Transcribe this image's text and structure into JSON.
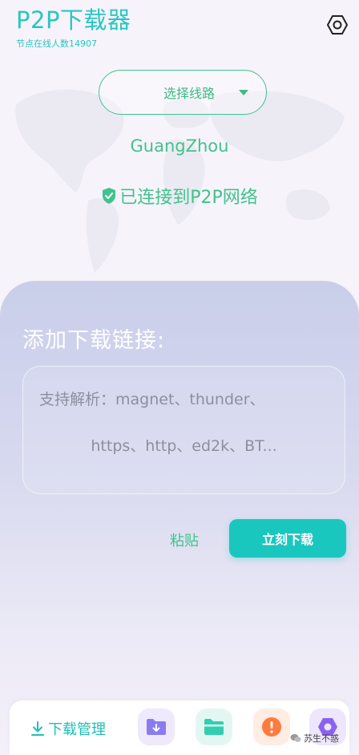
{
  "header": {
    "title": "P2P下载器",
    "online_label": "节点在线人数",
    "online_count": "14907"
  },
  "route": {
    "label": "选择线路"
  },
  "city": "GuangZhou",
  "status": "已连接到P2P网络",
  "panel": {
    "title": "添加下载链接:",
    "placeholder_line1": "支持解析：magnet、thunder、",
    "placeholder_line2": "https、http、ed2k、BT..."
  },
  "actions": {
    "paste": "粘贴",
    "download": "立刻下载"
  },
  "bottom_nav": {
    "download_manager": "下载管理"
  },
  "watermark": "苏生不惑",
  "colors": {
    "accent": "#27c7c2",
    "green": "#41c38a",
    "download_button": "#1ac7bf",
    "purple_icon": "#8a7cf0",
    "teal_icon": "#31cfb0",
    "orange_icon": "#ff7a3d",
    "violet_icon": "#8a62f0"
  }
}
